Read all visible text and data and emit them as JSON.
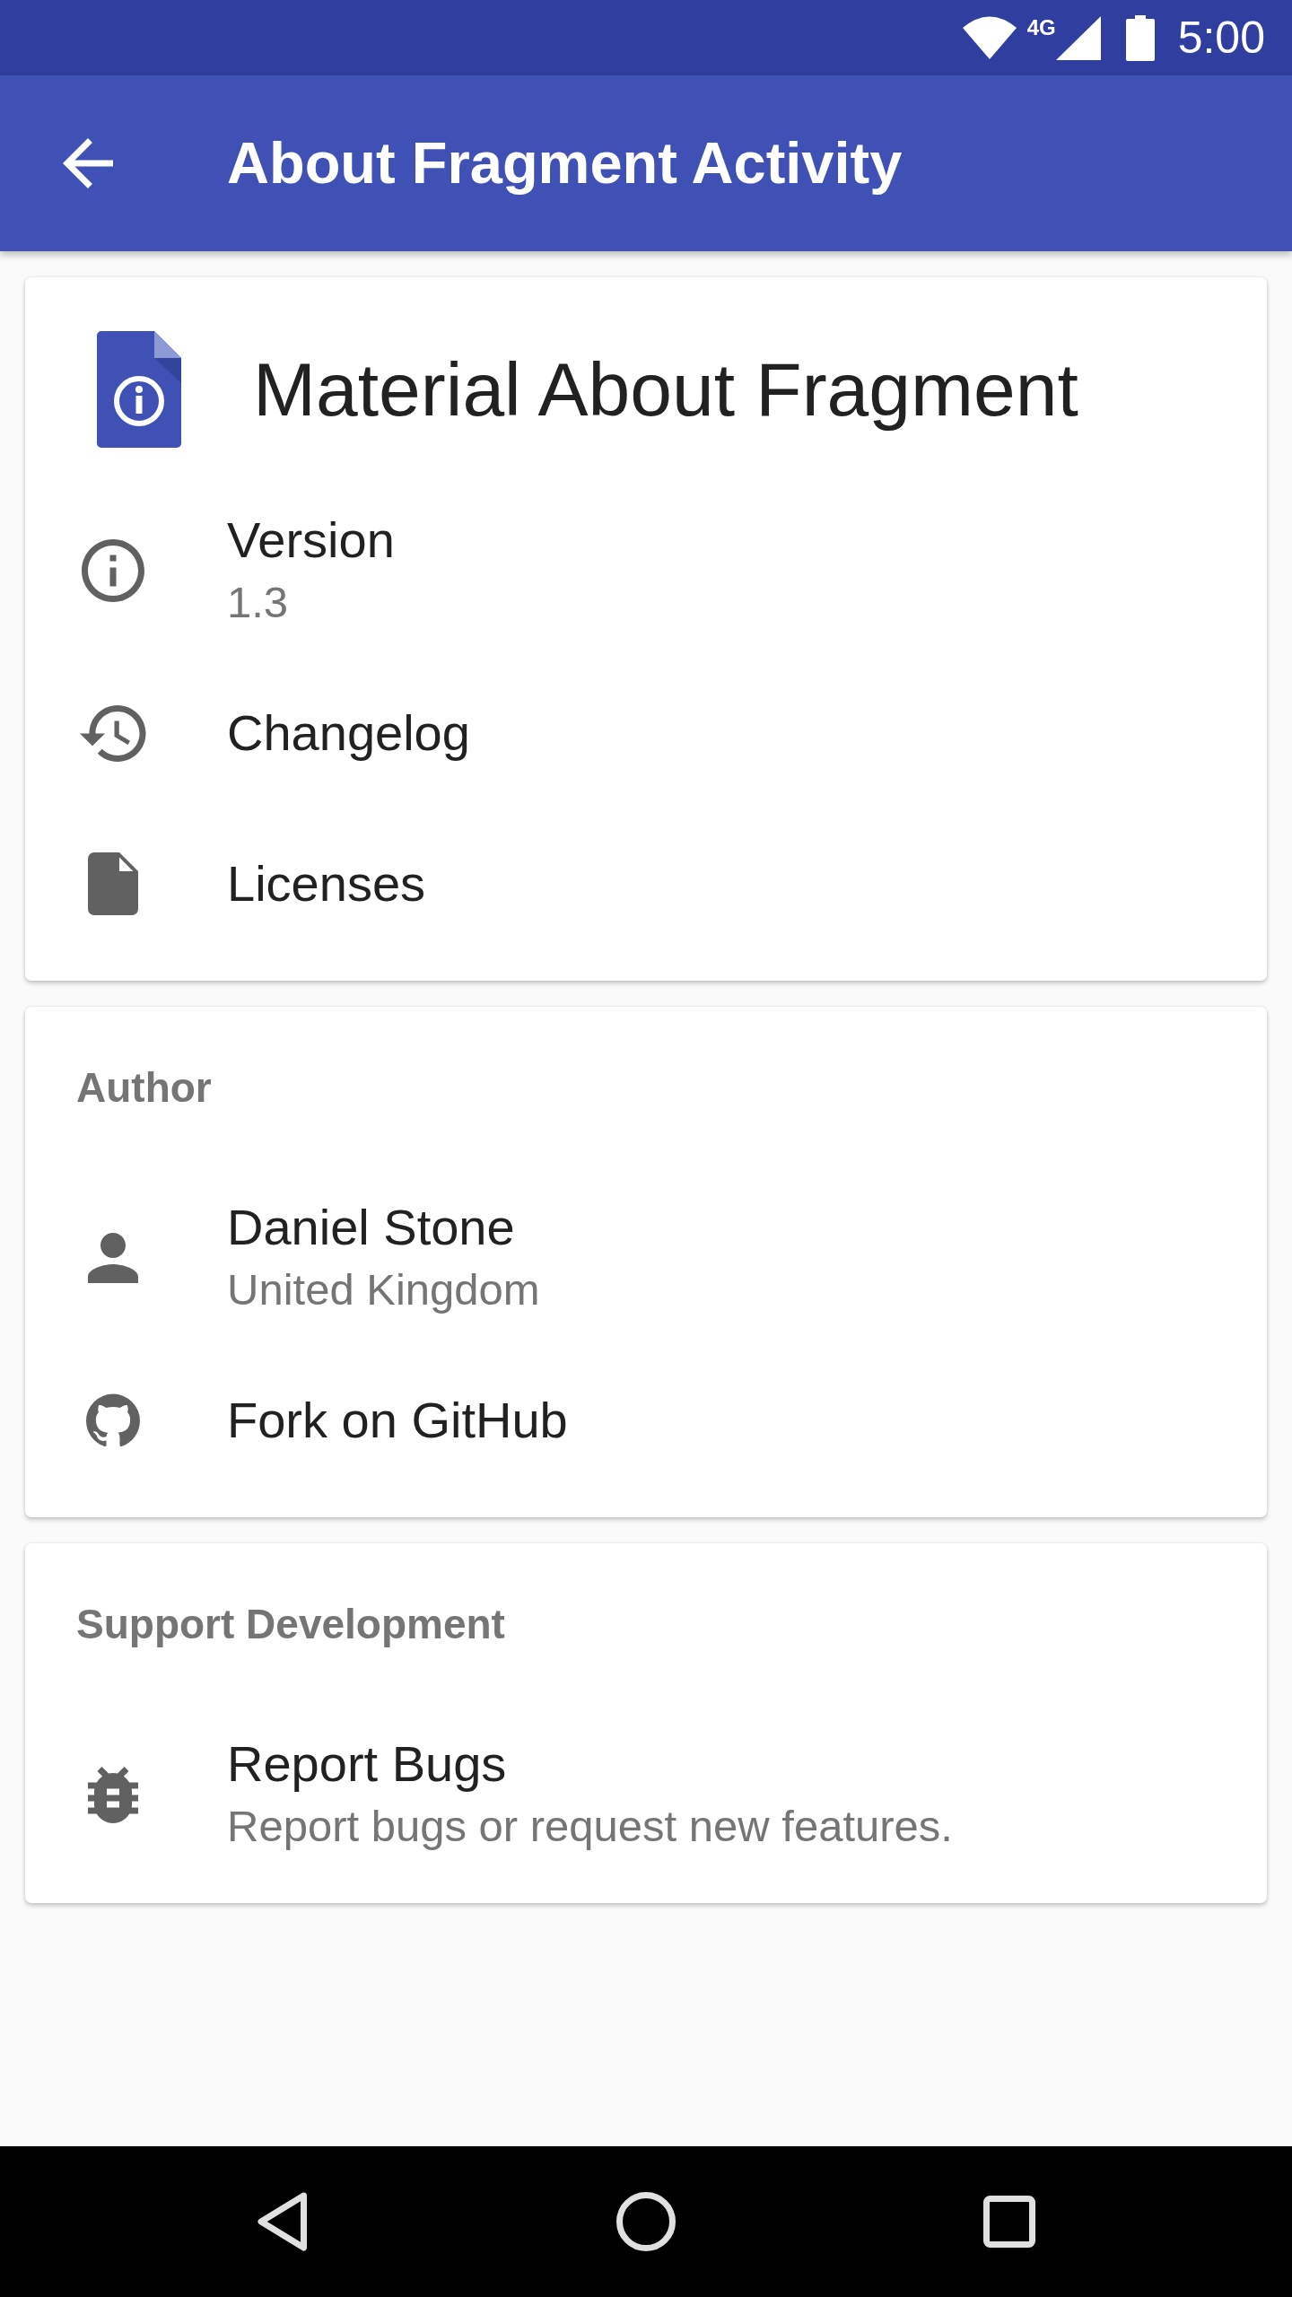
{
  "status_bar": {
    "network_type": "4G",
    "time": "5:00"
  },
  "app_bar": {
    "title": "About Fragment Activity"
  },
  "cards": [
    {
      "kind": "app",
      "title": "Material About Fragment",
      "items": [
        {
          "text": "Version",
          "subtext": "1.3"
        },
        {
          "text": "Changelog"
        },
        {
          "text": "Licenses"
        }
      ]
    },
    {
      "kind": "section",
      "title": "Author",
      "items": [
        {
          "text": "Daniel Stone",
          "subtext": "United Kingdom"
        },
        {
          "text": "Fork on GitHub"
        }
      ]
    },
    {
      "kind": "section",
      "title": "Support Development",
      "items": [
        {
          "text": "Report Bugs",
          "subtext": "Report bugs or request new features."
        }
      ]
    }
  ]
}
